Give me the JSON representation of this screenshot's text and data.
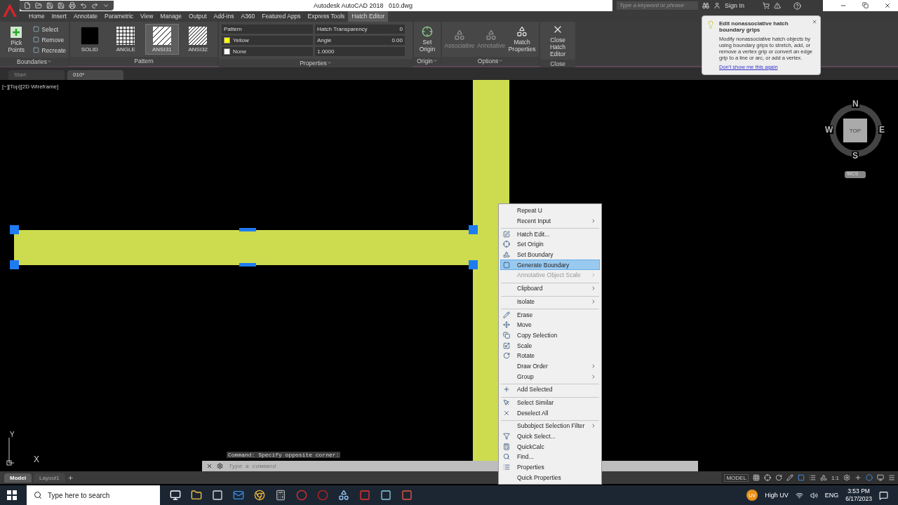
{
  "title": {
    "app": "Autodesk AutoCAD 2018",
    "file": "010.dwg"
  },
  "search": {
    "placeholder": "Type a keyword or phrase"
  },
  "sign_in": "Sign In",
  "ribbon_tabs": [
    {
      "label": "Home",
      "selected": false
    },
    {
      "label": "Insert",
      "selected": false
    },
    {
      "label": "Annotate",
      "selected": false
    },
    {
      "label": "Parametric",
      "selected": false
    },
    {
      "label": "View",
      "selected": false
    },
    {
      "label": "Manage",
      "selected": false
    },
    {
      "label": "Output",
      "selected": false
    },
    {
      "label": "Add-ins",
      "selected": false
    },
    {
      "label": "A360",
      "selected": false
    },
    {
      "label": "Featured Apps",
      "selected": false
    },
    {
      "label": "Express Tools",
      "selected": false
    },
    {
      "label": "Hatch Editor",
      "selected": true
    }
  ],
  "boundaries": {
    "title": "Boundaries",
    "pick": "Pick Points",
    "items": [
      "Select",
      "Remove",
      "Recreate"
    ]
  },
  "pattern": {
    "title": "Pattern",
    "swatches": [
      {
        "label": "SOLID",
        "kind": "solid",
        "selected": false
      },
      {
        "label": "ANGLE",
        "kind": "grid",
        "selected": false
      },
      {
        "label": "ANSI31",
        "kind": "hatch",
        "selected": true
      },
      {
        "label": "ANSI32",
        "kind": "dense",
        "selected": false
      }
    ]
  },
  "properties": {
    "title": "Properties",
    "type": "Pattern",
    "color": {
      "label": "Yellow",
      "color": "#ffff00"
    },
    "background": "None",
    "transparency": {
      "label": "Hatch Transparency",
      "value": "0"
    },
    "angle": {
      "label": "Angle",
      "value": "0.00"
    },
    "scale": "1.0000"
  },
  "origin": {
    "title": "Origin",
    "button": "Set Origin"
  },
  "options": {
    "title": "Options",
    "buttons": [
      {
        "label": "Associative",
        "disabled": true
      },
      {
        "label": "Annotative",
        "disabled": true
      },
      {
        "label": "Match Properties",
        "disabled": false
      }
    ]
  },
  "close": {
    "title": "Close",
    "button": "Close Hatch Editor"
  },
  "doc_tabs": [
    {
      "label": "Start",
      "selected": false
    },
    {
      "label": "010*",
      "selected": true
    }
  ],
  "viewport_label": "[−][Top][2D Wireframe]",
  "tooltip": {
    "title": "Edit nonassociative hatch boundary grips",
    "body": "Modify nonassociative hatch objects by using boundary grips to stretch, add, or remove a vertex grip or convert an edge grip to a line or arc, or add a vertex.",
    "link": "Don't show me this again"
  },
  "viewcube": {
    "n": "N",
    "e": "E",
    "s": "S",
    "w": "W",
    "face": "TOP",
    "wcs": "WCS"
  },
  "ucs": {
    "x": "X",
    "y": "Y"
  },
  "context_menu": [
    {
      "label": "Repeat U",
      "icon": false,
      "submenu": false,
      "disabled": false,
      "selected": false,
      "separator_before": false
    },
    {
      "label": "Recent Input",
      "icon": false,
      "submenu": true,
      "disabled": false,
      "selected": false,
      "separator_before": false
    },
    {
      "label": "Hatch Edit...",
      "icon": true,
      "submenu": false,
      "disabled": false,
      "selected": false,
      "separator_before": true
    },
    {
      "label": "Set Origin",
      "icon": true,
      "submenu": false,
      "disabled": false,
      "selected": false,
      "separator_before": false
    },
    {
      "label": "Set Boundary",
      "icon": true,
      "submenu": false,
      "disabled": false,
      "selected": false,
      "separator_before": false
    },
    {
      "label": "Generate Boundary",
      "icon": true,
      "submenu": false,
      "disabled": false,
      "selected": true,
      "separator_before": false
    },
    {
      "label": "Annotative Object Scale",
      "icon": false,
      "submenu": true,
      "disabled": true,
      "selected": false,
      "separator_before": false
    },
    {
      "label": "Clipboard",
      "icon": false,
      "submenu": true,
      "disabled": false,
      "selected": false,
      "separator_before": true
    },
    {
      "label": "Isolate",
      "icon": false,
      "submenu": true,
      "disabled": false,
      "selected": false,
      "separator_before": true
    },
    {
      "label": "Erase",
      "icon": true,
      "submenu": false,
      "disabled": false,
      "selected": false,
      "separator_before": true
    },
    {
      "label": "Move",
      "icon": true,
      "submenu": false,
      "disabled": false,
      "selected": false,
      "separator_before": false
    },
    {
      "label": "Copy Selection",
      "icon": true,
      "submenu": false,
      "disabled": false,
      "selected": false,
      "separator_before": false
    },
    {
      "label": "Scale",
      "icon": true,
      "submenu": false,
      "disabled": false,
      "selected": false,
      "separator_before": false
    },
    {
      "label": "Rotate",
      "icon": true,
      "submenu": false,
      "disabled": false,
      "selected": false,
      "separator_before": false
    },
    {
      "label": "Draw Order",
      "icon": false,
      "submenu": true,
      "disabled": false,
      "selected": false,
      "separator_before": false
    },
    {
      "label": "Group",
      "icon": false,
      "submenu": true,
      "disabled": false,
      "selected": false,
      "separator_before": false
    },
    {
      "label": "Add Selected",
      "icon": true,
      "submenu": false,
      "disabled": false,
      "selected": false,
      "separator_before": true
    },
    {
      "label": "Select Similar",
      "icon": true,
      "submenu": false,
      "disabled": false,
      "selected": false,
      "separator_before": true
    },
    {
      "label": "Deselect All",
      "icon": true,
      "submenu": false,
      "disabled": false,
      "selected": false,
      "separator_before": false
    },
    {
      "label": "Subobject Selection Filter",
      "icon": false,
      "submenu": true,
      "disabled": false,
      "selected": false,
      "separator_before": true
    },
    {
      "label": "Quick Select...",
      "icon": true,
      "submenu": false,
      "disabled": false,
      "selected": false,
      "separator_before": false
    },
    {
      "label": "QuickCalc",
      "icon": true,
      "submenu": false,
      "disabled": false,
      "selected": false,
      "separator_before": false
    },
    {
      "label": "Find...",
      "icon": true,
      "submenu": false,
      "disabled": false,
      "selected": false,
      "separator_before": false
    },
    {
      "label": "Properties",
      "icon": true,
      "submenu": false,
      "disabled": false,
      "selected": false,
      "separator_before": false
    },
    {
      "label": "Quick Properties",
      "icon": false,
      "submenu": false,
      "disabled": false,
      "selected": false,
      "separator_before": false
    }
  ],
  "command": {
    "history": "Command: Specify opposite corner:",
    "placeholder": "Type a command"
  },
  "layout_tabs": [
    {
      "label": "Model",
      "selected": true
    },
    {
      "label": "Layout1",
      "selected": false
    }
  ],
  "status_bar": {
    "model": "MODEL",
    "scale": "1:1"
  },
  "taskbar": {
    "search_placeholder": "Type here to search",
    "weather": "High UV",
    "weather_badge": "UV",
    "language": "ENG",
    "time": "3:53 PM",
    "date": "6/17/2023"
  }
}
